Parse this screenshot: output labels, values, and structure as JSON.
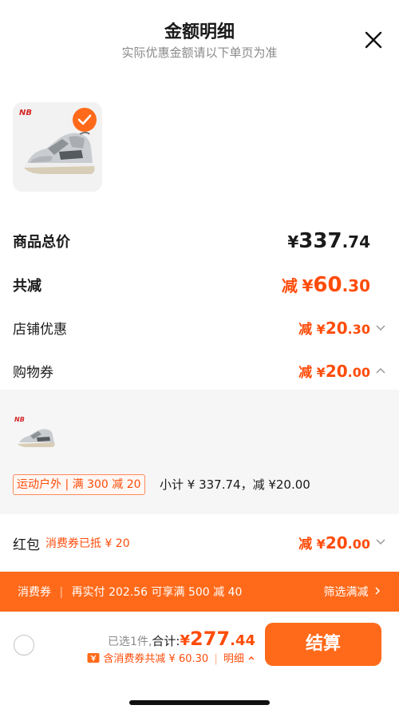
{
  "header": {
    "title": "金额明细",
    "subtitle": "实际优惠金额请以下单页为准"
  },
  "summary": {
    "goods_total_label": "商品总价",
    "goods_total_currency": "¥",
    "goods_total_int": "337",
    "goods_total_dec": ".74",
    "total_discount_label": "共减",
    "total_discount_prefix": "减",
    "total_discount_currency": "¥",
    "total_discount_int": "60",
    "total_discount_dec": ".30",
    "store_discount_label": "店铺优惠",
    "store_discount_prefix": "减",
    "store_discount_currency": "¥",
    "store_discount_int": "20",
    "store_discount_dec": ".30",
    "coupon_label": "购物券",
    "coupon_prefix": "减",
    "coupon_currency": "¥",
    "coupon_int": "20",
    "coupon_dec": ".00"
  },
  "coupon_detail": {
    "promo_tag": "运动户外 | 满 300 减 20",
    "subtotal": "小计 ¥ 337.74，减 ¥20.00"
  },
  "red_packet": {
    "label": "红包",
    "note": "消费券已抵 ¥ 20",
    "prefix": "减",
    "currency": "¥",
    "int": "20",
    "dec": ".00"
  },
  "banner": {
    "tag": "消费券",
    "text": "再实付 202.56 可享满 500 减 40",
    "action": "筛选满减"
  },
  "bottom": {
    "selected": "已选1件,",
    "total_label": "合计:",
    "total_currency": "¥",
    "total_int": "277",
    "total_dec": ".44",
    "includes": "含消费券共减 ¥ 60.30",
    "detail": "明细",
    "pay_button": "结算"
  },
  "colors": {
    "accent": "#ff6a1a",
    "price_red": "#ff4c0a",
    "panel_bg": "#f6f6f6"
  }
}
